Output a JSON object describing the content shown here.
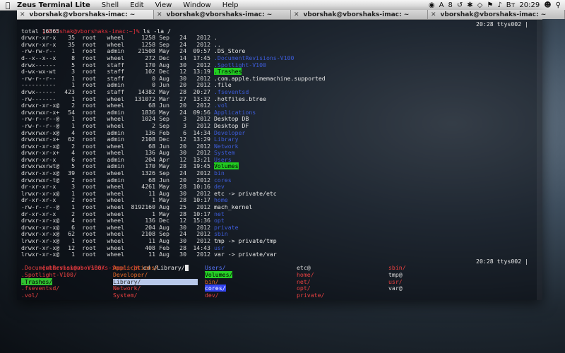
{
  "menubar": {
    "app": "Zeus Terminal Lite",
    "items": [
      "Shell",
      "Edit",
      "View",
      "Window",
      "Help"
    ],
    "status": {
      "notif": "A",
      "count": "8",
      "lang": "Вт",
      "time": "20:29"
    }
  },
  "tabs": [
    {
      "label": "vborshak@vborshaks-imac: ~",
      "active": true
    },
    {
      "label": "vborshak@vborshaks-imac: ~",
      "active": false
    },
    {
      "label": "vborshak@vborshaks-imac: ~",
      "active": false
    },
    {
      "label": "vborshak@vborshaks-imac: ~",
      "active": false
    }
  ],
  "prompt1": {
    "prompt": "[vborshak@vborshaks-imac:~]% ",
    "cmd": "ls -la /",
    "right": "20:28 ttys002 |"
  },
  "total": "total 16365",
  "listing": [
    {
      "perm": "drwxr-xr-x",
      "links": "35",
      "owner": "root",
      "group": "wheel",
      "size": "1258",
      "mon": "Sep",
      "day": "24",
      "time": "2012",
      "name": ".",
      "cls": "n-plain"
    },
    {
      "perm": "drwxr-xr-x",
      "links": "35",
      "owner": "root",
      "group": "wheel",
      "size": "1258",
      "mon": "Sep",
      "day": "24",
      "time": "2012",
      "name": "..",
      "cls": "n-plain"
    },
    {
      "perm": "-rw-rw-r--",
      "links": "1",
      "owner": "root",
      "group": "admin",
      "size": "21508",
      "mon": "May",
      "day": "24",
      "time": "09:57",
      "name": ".DS_Store",
      "cls": "n-plain"
    },
    {
      "perm": "d--x--x--x",
      "links": "8",
      "owner": "root",
      "group": "wheel",
      "size": "272",
      "mon": "Dec",
      "day": "14",
      "time": "17:45",
      "name": ".DocumentRevisions-V100",
      "cls": "n-dir"
    },
    {
      "perm": "drwx------",
      "links": "5",
      "owner": "root",
      "group": "staff",
      "size": "170",
      "mon": "Aug",
      "day": "30",
      "time": "2012",
      "name": ".Spotlight-V100",
      "cls": "n-dir"
    },
    {
      "perm": "d-wx-wx-wt",
      "links": "3",
      "owner": "root",
      "group": "staff",
      "size": "102",
      "mon": "Dec",
      "day": "12",
      "time": "13:19",
      "name": ".Trashes",
      "cls": "n-dirhl"
    },
    {
      "perm": "-rw-r--r--",
      "links": "1",
      "owner": "root",
      "group": "staff",
      "size": "0",
      "mon": "Aug",
      "day": "30",
      "time": "2012",
      "name": ".com.apple.timemachine.supported",
      "cls": "n-plain"
    },
    {
      "perm": "----------",
      "links": "1",
      "owner": "root",
      "group": "admin",
      "size": "0",
      "mon": "Jun",
      "day": "20",
      "time": "2012",
      "name": ".file",
      "cls": "n-plain"
    },
    {
      "perm": "drwx------",
      "links": "423",
      "owner": "root",
      "group": "staff",
      "size": "14382",
      "mon": "May",
      "day": "28",
      "time": "20:27",
      "name": ".fseventsd",
      "cls": "n-dir"
    },
    {
      "perm": "-rw-------",
      "links": "1",
      "owner": "root",
      "group": "wheel",
      "size": "131072",
      "mon": "Mar",
      "day": "27",
      "time": "13:32",
      "name": ".hotfiles.btree",
      "cls": "n-plain"
    },
    {
      "perm": "drwxr-xr-x@",
      "links": "2",
      "owner": "root",
      "group": "wheel",
      "size": "68",
      "mon": "Jun",
      "day": "20",
      "time": "2012",
      "name": ".vol",
      "cls": "n-dir"
    },
    {
      "perm": "drwxrwxr-x+",
      "links": "54",
      "owner": "root",
      "group": "admin",
      "size": "1836",
      "mon": "May",
      "day": "24",
      "time": "09:56",
      "name": "Applications",
      "cls": "n-dir"
    },
    {
      "perm": "-rw-r--r--@",
      "links": "1",
      "owner": "root",
      "group": "wheel",
      "size": "1024",
      "mon": "Sep",
      "day": "3",
      "time": "2012",
      "name": "Desktop DB",
      "cls": "n-plain"
    },
    {
      "perm": "-rw-r--r--@",
      "links": "1",
      "owner": "root",
      "group": "wheel",
      "size": "2",
      "mon": "Sep",
      "day": "3",
      "time": "2012",
      "name": "Desktop DF",
      "cls": "n-plain"
    },
    {
      "perm": "drwxrwxr-x@",
      "links": "4",
      "owner": "root",
      "group": "admin",
      "size": "136",
      "mon": "Feb",
      "day": "6",
      "time": "14:34",
      "name": "Developer",
      "cls": "n-dir"
    },
    {
      "perm": "drwxrwxr-x+",
      "links": "62",
      "owner": "root",
      "group": "admin",
      "size": "2108",
      "mon": "Dec",
      "day": "12",
      "time": "13:29",
      "name": "Library",
      "cls": "n-dir"
    },
    {
      "perm": "drwxr-xr-x@",
      "links": "2",
      "owner": "root",
      "group": "wheel",
      "size": "68",
      "mon": "Jun",
      "day": "20",
      "time": "2012",
      "name": "Network",
      "cls": "n-dir"
    },
    {
      "perm": "drwxr-xr-x+",
      "links": "4",
      "owner": "root",
      "group": "wheel",
      "size": "136",
      "mon": "Aug",
      "day": "30",
      "time": "2012",
      "name": "System",
      "cls": "n-dir"
    },
    {
      "perm": "drwxr-xr-x",
      "links": "6",
      "owner": "root",
      "group": "admin",
      "size": "204",
      "mon": "Apr",
      "day": "12",
      "time": "13:21",
      "name": "Users",
      "cls": "n-dir"
    },
    {
      "perm": "drwxrwxrwt@",
      "links": "5",
      "owner": "root",
      "group": "admin",
      "size": "170",
      "mon": "May",
      "day": "28",
      "time": "19:45",
      "name": "Volumes",
      "cls": "n-dirhl"
    },
    {
      "perm": "drwxr-xr-x@",
      "links": "39",
      "owner": "root",
      "group": "wheel",
      "size": "1326",
      "mon": "Sep",
      "day": "24",
      "time": "2012",
      "name": "bin",
      "cls": "n-dir"
    },
    {
      "perm": "drwxrwxr-t@",
      "links": "2",
      "owner": "root",
      "group": "admin",
      "size": "68",
      "mon": "Jun",
      "day": "20",
      "time": "2012",
      "name": "cores",
      "cls": "n-dir"
    },
    {
      "perm": "dr-xr-xr-x",
      "links": "3",
      "owner": "root",
      "group": "wheel",
      "size": "4261",
      "mon": "May",
      "day": "28",
      "time": "10:16",
      "name": "dev",
      "cls": "n-dir"
    },
    {
      "perm": "lrwxr-xr-x@",
      "links": "1",
      "owner": "root",
      "group": "wheel",
      "size": "11",
      "mon": "Aug",
      "day": "30",
      "time": "2012",
      "name": "etc -> private/etc",
      "cls": "n-plain"
    },
    {
      "perm": "dr-xr-xr-x",
      "links": "2",
      "owner": "root",
      "group": "wheel",
      "size": "1",
      "mon": "May",
      "day": "28",
      "time": "10:17",
      "name": "home",
      "cls": "n-dir"
    },
    {
      "perm": "-rw-r--r--@",
      "links": "1",
      "owner": "root",
      "group": "wheel",
      "size": "8192160",
      "mon": "Aug",
      "day": "25",
      "time": "2012",
      "name": "mach_kernel",
      "cls": "n-plain"
    },
    {
      "perm": "dr-xr-xr-x",
      "links": "2",
      "owner": "root",
      "group": "wheel",
      "size": "1",
      "mon": "May",
      "day": "28",
      "time": "10:17",
      "name": "net",
      "cls": "n-dir"
    },
    {
      "perm": "drwxr-xr-x@",
      "links": "4",
      "owner": "root",
      "group": "wheel",
      "size": "136",
      "mon": "Dec",
      "day": "12",
      "time": "15:36",
      "name": "opt",
      "cls": "n-dir"
    },
    {
      "perm": "drwxr-xr-x@",
      "links": "6",
      "owner": "root",
      "group": "wheel",
      "size": "204",
      "mon": "Aug",
      "day": "30",
      "time": "2012",
      "name": "private",
      "cls": "n-dir"
    },
    {
      "perm": "drwxr-xr-x@",
      "links": "62",
      "owner": "root",
      "group": "wheel",
      "size": "2108",
      "mon": "Sep",
      "day": "24",
      "time": "2012",
      "name": "sbin",
      "cls": "n-dir"
    },
    {
      "perm": "lrwxr-xr-x@",
      "links": "1",
      "owner": "root",
      "group": "wheel",
      "size": "11",
      "mon": "Aug",
      "day": "30",
      "time": "2012",
      "name": "tmp -> private/tmp",
      "cls": "n-plain"
    },
    {
      "perm": "drwxr-xr-x@",
      "links": "12",
      "owner": "root",
      "group": "wheel",
      "size": "408",
      "mon": "Feb",
      "day": "28",
      "time": "14:43",
      "name": "usr",
      "cls": "n-dir"
    },
    {
      "perm": "lrwxr-xr-x@",
      "links": "1",
      "owner": "root",
      "group": "wheel",
      "size": "11",
      "mon": "Aug",
      "day": "30",
      "time": "2012",
      "name": "var -> private/var",
      "cls": "n-plain"
    }
  ],
  "prompt2": {
    "prompt": "[vborshak@vborshaks-imac:~]% ",
    "cmd": "cd /Library/",
    "right": "20:28 ttys002 |"
  },
  "completion": [
    [
      {
        "t": ".DocumentRevisions-V100/",
        "c": "g-red"
      },
      {
        "t": "Applications/",
        "c": "g-orange"
      },
      {
        "t": "Users/",
        "c": "g-blue"
      },
      {
        "t": "etc@",
        "c": "g-cyan"
      },
      {
        "t": "sbin/",
        "c": "g-red"
      }
    ],
    [
      {
        "t": ".Spotlight-V100/",
        "c": "g-red"
      },
      {
        "t": "Developer/",
        "c": "g-orange"
      },
      {
        "t": "Volumes/",
        "c": "g-hl"
      },
      {
        "t": "home/",
        "c": "g-red"
      },
      {
        "t": "tmp@",
        "c": "g-cyan"
      }
    ],
    [
      {
        "t": ".Trashes/",
        "c": "g-cyanbg"
      },
      {
        "t": "Library/",
        "c": "g-selbg"
      },
      {
        "t": "bin/",
        "c": "g-orange"
      },
      {
        "t": "net/",
        "c": "g-red"
      },
      {
        "t": "usr/",
        "c": "g-red"
      }
    ],
    [
      {
        "t": ".fseventsd/",
        "c": "g-red"
      },
      {
        "t": "Network/",
        "c": "g-red"
      },
      {
        "t": "cores/",
        "c": "g-yellowbg"
      },
      {
        "t": "opt/",
        "c": "g-red"
      },
      {
        "t": "var@",
        "c": "g-cyan"
      }
    ],
    [
      {
        "t": ".vol/",
        "c": "g-red"
      },
      {
        "t": "System/",
        "c": "g-red"
      },
      {
        "t": "dev/",
        "c": "g-red"
      },
      {
        "t": "private/",
        "c": "g-red"
      },
      {
        "t": "",
        "c": "g-white"
      }
    ]
  ]
}
